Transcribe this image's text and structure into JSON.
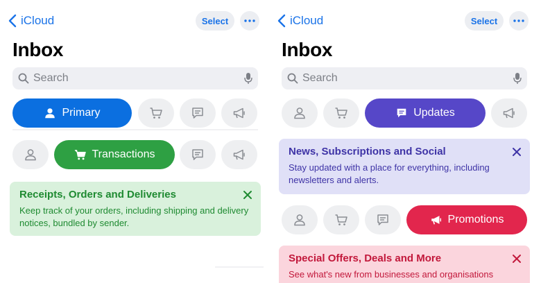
{
  "colors": {
    "ios_blue": "#1a73e8",
    "primary_blue": "#0b6fe0",
    "transactions_green": "#2ea043",
    "updates_purple": "#5647c8",
    "promotions_red": "#e2264d",
    "chip_gray": "#eeeff1",
    "card_green_bg": "#d9f1dc",
    "card_green_text": "#1e8a31",
    "card_purple_bg": "#e0e0f7",
    "card_purple_text": "#3e33a6",
    "card_red_bg": "#fbd5dd",
    "card_red_text": "#c2183b"
  },
  "left": {
    "back_label": "iCloud",
    "select_label": "Select",
    "title": "Inbox",
    "search_placeholder": "Search",
    "tabs_row1": {
      "active_label": "Primary"
    },
    "tabs_row2": {
      "active_label": "Transactions"
    },
    "card": {
      "title": "Receipts, Orders and Deliveries",
      "body": "Keep track of your orders, including shipping and delivery notices, bundled by sender."
    }
  },
  "right": {
    "back_label": "iCloud",
    "select_label": "Select",
    "title": "Inbox",
    "search_placeholder": "Search",
    "tabs_row1": {
      "active_label": "Updates"
    },
    "card1": {
      "title": "News, Subscriptions and Social",
      "body": "Stay updated with a place for everything, including newsletters and alerts."
    },
    "tabs_row2": {
      "active_label": "Promotions"
    },
    "card2": {
      "title": "Special Offers, Deals and More",
      "body": "See what's new from businesses and organisations"
    }
  },
  "icons": [
    "chevron-left-icon",
    "ellipsis-icon",
    "search-icon",
    "microphone-icon",
    "person-icon",
    "cart-icon",
    "message-icon",
    "megaphone-icon",
    "close-icon"
  ]
}
